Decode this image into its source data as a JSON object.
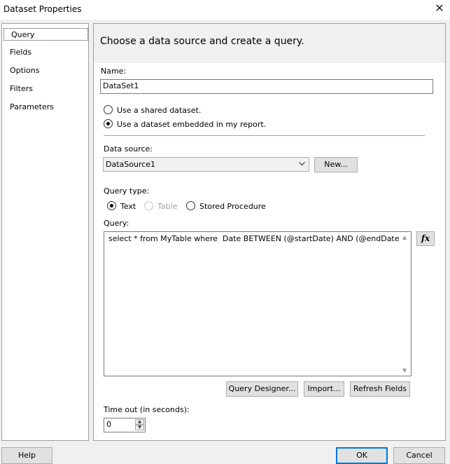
{
  "window": {
    "title": "Dataset Properties",
    "close_glyph": "✕"
  },
  "nav": {
    "items": [
      {
        "label": "Query",
        "selected": true
      },
      {
        "label": "Fields"
      },
      {
        "label": "Options"
      },
      {
        "label": "Filters"
      },
      {
        "label": "Parameters"
      }
    ]
  },
  "header": {
    "text": "Choose a data source and create a query."
  },
  "name": {
    "label": "Name:",
    "value": "DataSet1"
  },
  "dataset_type": {
    "shared_label": "Use a shared dataset.",
    "embedded_label": "Use a dataset embedded in my report.",
    "selected": "embedded"
  },
  "data_source": {
    "label": "Data source:",
    "value": "DataSource1",
    "new_button": "New..."
  },
  "query_type": {
    "label": "Query type:",
    "options": [
      "Text",
      "Table",
      "Stored Procedure"
    ],
    "selected": "Text",
    "disabled": [
      "Table"
    ]
  },
  "query": {
    "label": "Query:",
    "text": "select * from MyTable where  Date BETWEEN (@startDate) AND (@endDate)",
    "fx_label": "fx"
  },
  "actions": {
    "designer": "Query Designer...",
    "import": "Import...",
    "refresh": "Refresh Fields"
  },
  "timeout": {
    "label": "Time out (in seconds):",
    "value": "0"
  },
  "footer": {
    "help": "Help",
    "ok": "OK",
    "cancel": "Cancel"
  },
  "colors": {
    "accent": "#0078d7",
    "panel_bg": "#ffffff",
    "window_bg": "#f0f0f0"
  }
}
